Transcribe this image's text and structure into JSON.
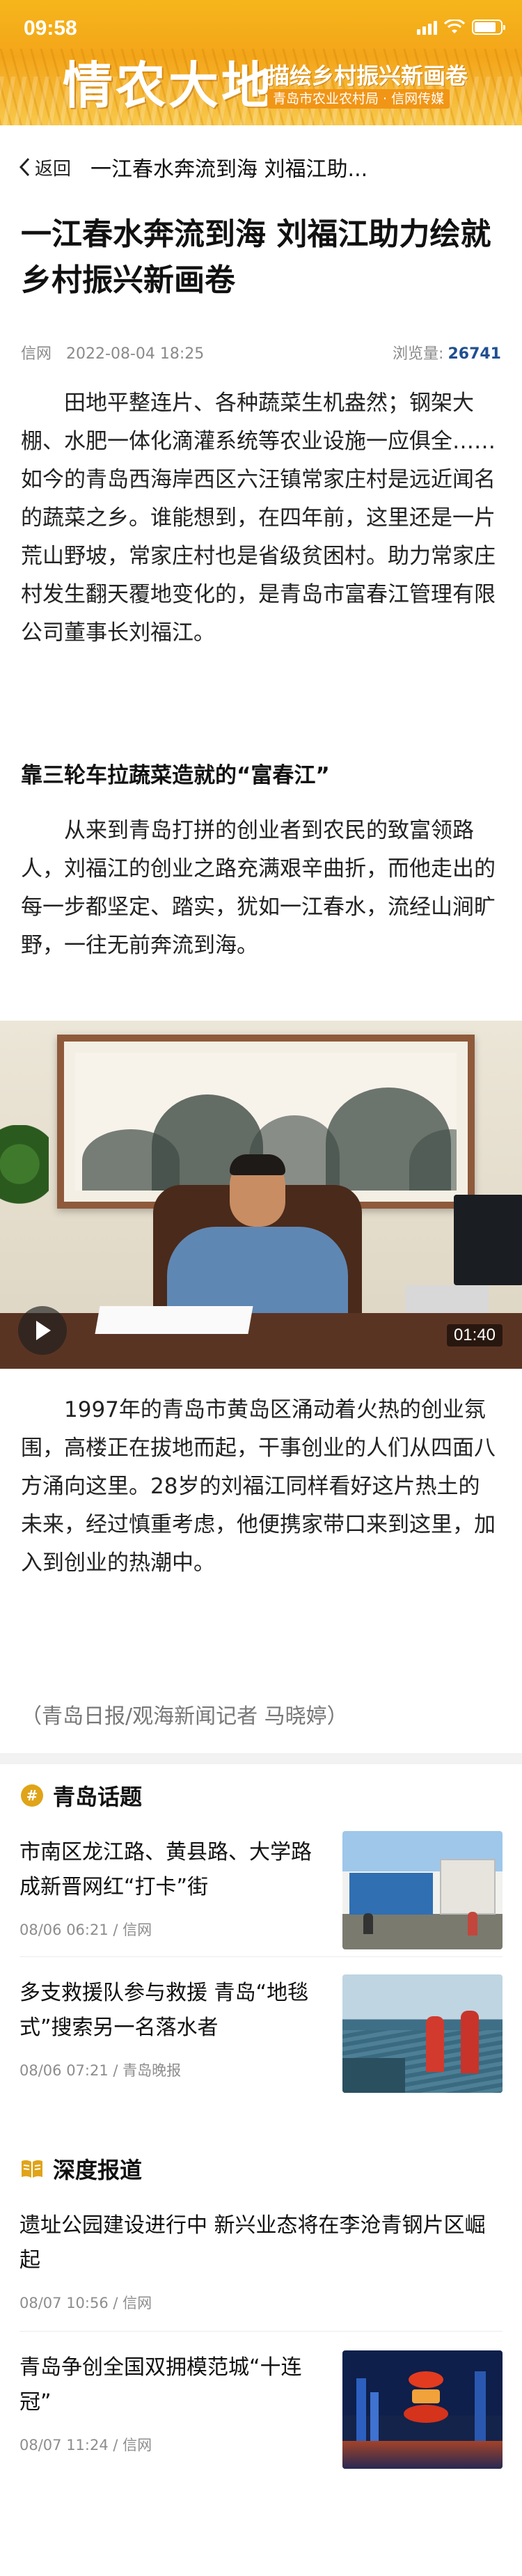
{
  "status": {
    "time": "09:58"
  },
  "banner": {
    "logo": "情农大地",
    "slogan": "描绘乡村振兴新画卷",
    "slogan_sub": "青岛市农业农村局 · 信网传媒"
  },
  "nav": {
    "back_label": "返回",
    "title": "一江春水奔流到海 刘福江助..."
  },
  "article": {
    "title": "一江春水奔流到海 刘福江助力绘就乡村振兴新画卷",
    "source": "信网",
    "date": "2022-08-04 18:25",
    "views_label": "浏览量:",
    "views": "26741",
    "p1": "田地平整连片、各种蔬菜生机盎然；钢架大棚、水肥一体化滴灌系统等农业设施一应俱全……如今的青岛西海岸西区六汪镇常家庄村是远近闻名的蔬菜之乡。谁能想到，在四年前，这里还是一片荒山野坡，常家庄村也是省级贫困村。助力常家庄村发生翻天覆地变化的，是青岛市富春江管理有限公司董事长刘福江。",
    "subhead": "靠三轮车拉蔬菜造就的“富春江”",
    "p2": "从来到青岛打拼的创业者到农民的致富领路人，刘福江的创业之路充满艰辛曲折，而他走出的每一步都坚定、踏实，犹如一江春水，流经山涧旷野，一往无前奔流到海。",
    "video_duration": "01:40",
    "p3": "1997年的青岛市黄岛区涌动着火热的创业氛围，高楼正在拔地而起，干事创业的人们从四面八方涌向这里。28岁的刘福江同样看好这片热土的未来，经过慎重考虑，他便携家带口来到这里，加入到创业的热潮中。",
    "byline": "（青岛日报/观海新闻记者 马晓婷）"
  },
  "sections": [
    {
      "title": "青岛话题",
      "items": [
        {
          "title": "市南区龙江路、黄县路、大学路成新晋网红“打卡”街",
          "info": "08/06 06:21 / 信网"
        },
        {
          "title": "多支救援队参与救援 青岛“地毯式”搜索另一名落水者",
          "info": "08/06 07:21 / 青岛晚报"
        }
      ]
    },
    {
      "title": "深度报道",
      "items": [
        {
          "title": "遗址公园建设进行中 新兴业态将在李沧青钢片区崛起",
          "info": "08/07 10:56 / 信网"
        },
        {
          "title": "青岛争创全国双拥模范城“十连冠”",
          "info": "08/07 11:24 / 信网"
        }
      ]
    }
  ],
  "colors": {
    "accent": "#f3a51a",
    "views": "#1f4f8f",
    "section_icon": "#e0a419"
  }
}
